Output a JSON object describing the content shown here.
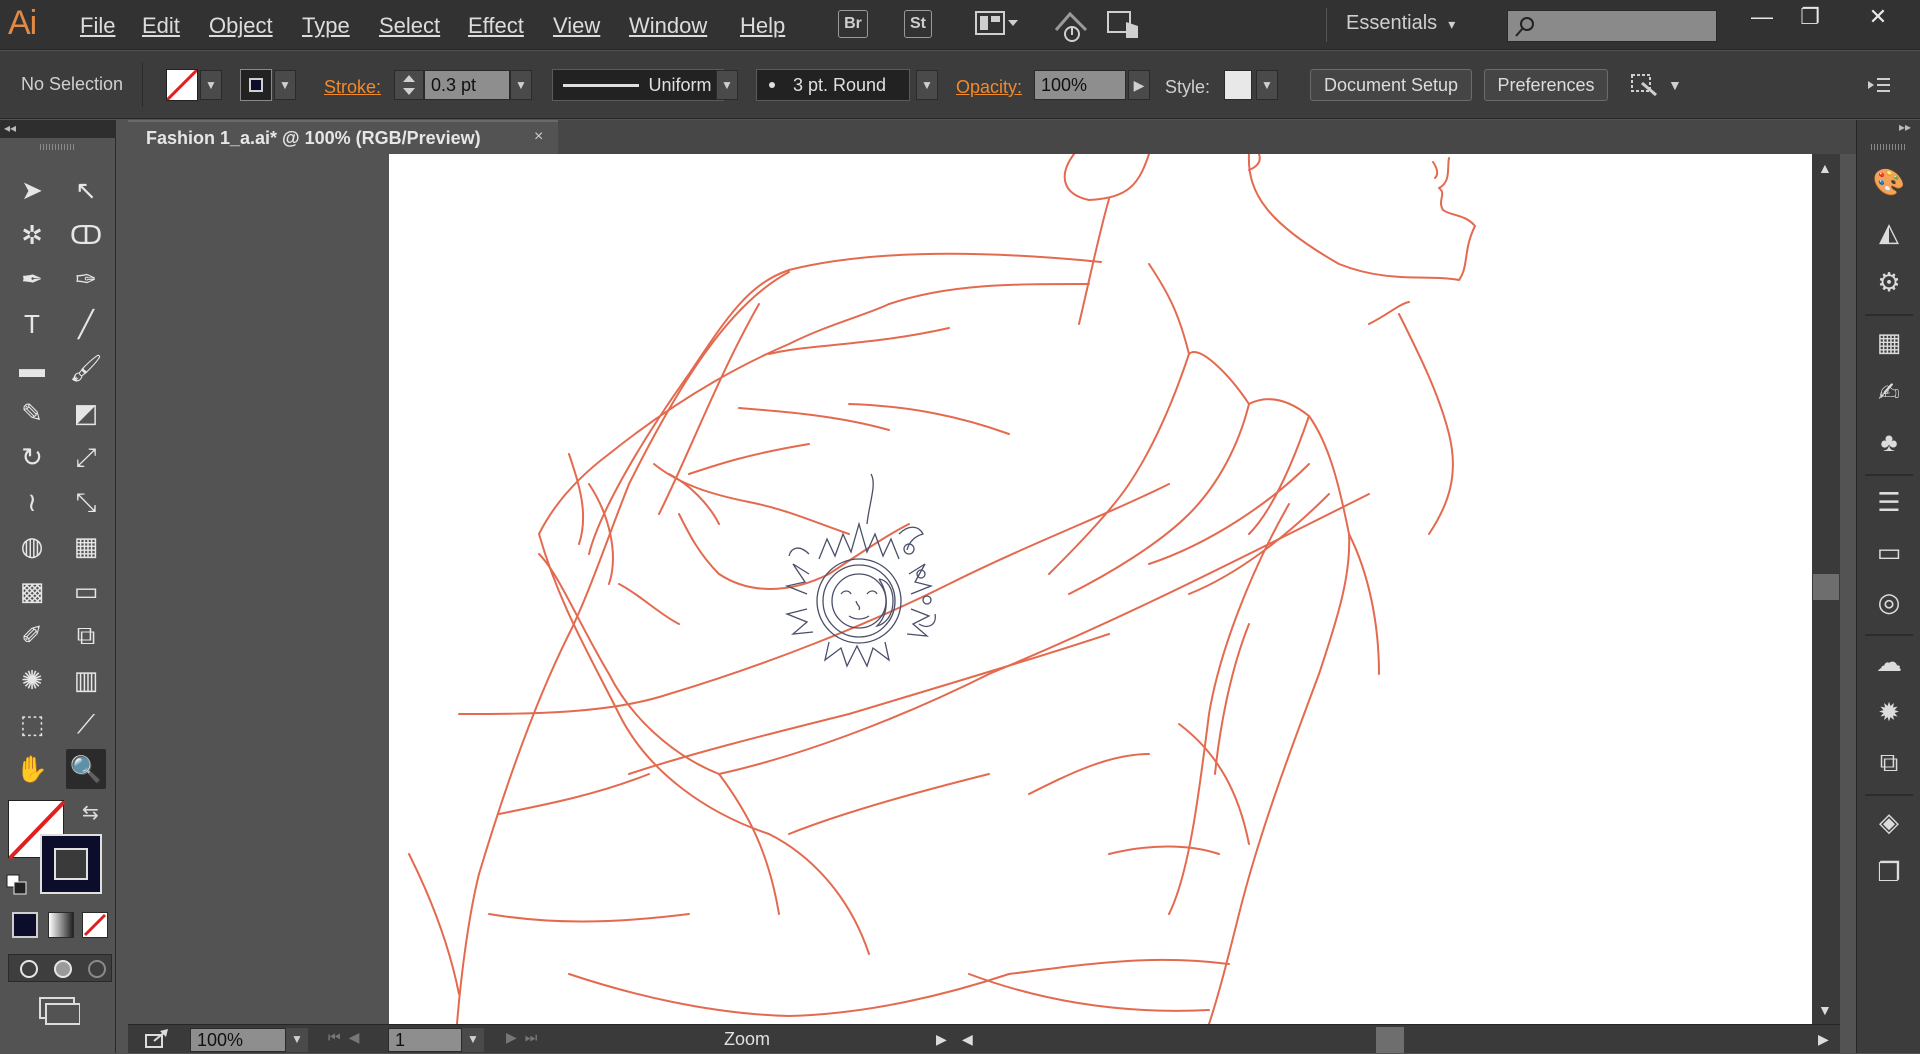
{
  "app": {
    "logo": "Ai"
  },
  "menu": [
    "File",
    "Edit",
    "Object",
    "Type",
    "Select",
    "Effect",
    "View",
    "Window",
    "Help"
  ],
  "bridge_buttons": [
    "Br",
    "St"
  ],
  "workspace": {
    "label": "Essentials",
    "chevron": "▾"
  },
  "search": {
    "placeholder": ""
  },
  "window_controls": {
    "minimize": "—",
    "restore": "❐",
    "close": "✕"
  },
  "control_bar": {
    "selection": "No Selection",
    "stroke_label": "Stroke:",
    "stroke_value": "0.3 pt",
    "profile": "Uniform",
    "brush": "3 pt. Round",
    "opacity_label": "Opacity:",
    "opacity_value": "100%",
    "style_label": "Style:",
    "document_setup": "Document Setup",
    "preferences": "Preferences"
  },
  "document": {
    "tab_title": "Fashion 1_a.ai* @ 100% (RGB/Preview)",
    "close": "×"
  },
  "status_bar": {
    "zoom": "100%",
    "artboard": "1",
    "status": "Zoom"
  },
  "tools": [
    [
      "selection-tool-icon",
      "➤"
    ],
    [
      "direct-selection-tool-icon",
      "↖"
    ],
    [
      "magic-wand-tool-icon",
      "✲"
    ],
    [
      "lasso-tool-icon",
      "ↀ"
    ],
    [
      "pen-tool-icon",
      "✒"
    ],
    [
      "curvature-tool-icon",
      "✑"
    ],
    [
      "type-tool-icon",
      "T"
    ],
    [
      "line-tool-icon",
      "╱"
    ],
    [
      "rectangle-tool-icon",
      "▬"
    ],
    [
      "paintbrush-tool-icon",
      "🖌"
    ],
    [
      "pencil-tool-icon",
      "✎"
    ],
    [
      "eraser-tool-icon",
      "◩"
    ],
    [
      "rotate-tool-icon",
      "↻"
    ],
    [
      "scale-tool-icon",
      "⤢"
    ],
    [
      "warp-tool-icon",
      "≀"
    ],
    [
      "free-transform-tool-icon",
      "⤡"
    ],
    [
      "shape-builder-tool-icon",
      "◍"
    ],
    [
      "perspective-grid-tool-icon",
      "▦"
    ],
    [
      "mesh-tool-icon",
      "▩"
    ],
    [
      "gradient-tool-icon",
      "▭"
    ],
    [
      "eyedropper-tool-icon",
      "✐"
    ],
    [
      "blend-tool-icon",
      "⧉"
    ],
    [
      "symbol-sprayer-tool-icon",
      "✺"
    ],
    [
      "column-graph-tool-icon",
      "▥"
    ],
    [
      "artboard-tool-icon",
      "⬚"
    ],
    [
      "slice-tool-icon",
      "⟋"
    ],
    [
      "hand-tool-icon",
      "✋"
    ],
    [
      "zoom-tool-icon",
      "🔍"
    ]
  ],
  "right_dock": [
    [
      "color-panel-icon",
      "🎨",
      0
    ],
    [
      "color-guide-panel-icon",
      "◭",
      0
    ],
    [
      "recolor-panel-icon",
      "⚙",
      0
    ],
    [
      "swatches-panel-icon",
      "▦",
      1
    ],
    [
      "brushes-panel-icon",
      "✍",
      0
    ],
    [
      "symbols-panel-icon",
      "♣",
      0
    ],
    [
      "stroke-panel-icon",
      "☰",
      1
    ],
    [
      "gradient-panel-icon",
      "▭",
      0
    ],
    [
      "transparency-panel-icon",
      "◎",
      0
    ],
    [
      "libraries-panel-icon",
      "☁",
      1
    ],
    [
      "appearance-panel-icon",
      "✹",
      0
    ],
    [
      "graphic-styles-panel-icon",
      "⧉",
      0
    ],
    [
      "layers-panel-icon",
      "◈",
      1
    ],
    [
      "artboards-panel-icon",
      "❐",
      0
    ]
  ],
  "colors": {
    "accent_orange": "#f08a2c",
    "artwork_stroke": "#e46a4f",
    "sun_stroke": "#4a4f6a"
  }
}
